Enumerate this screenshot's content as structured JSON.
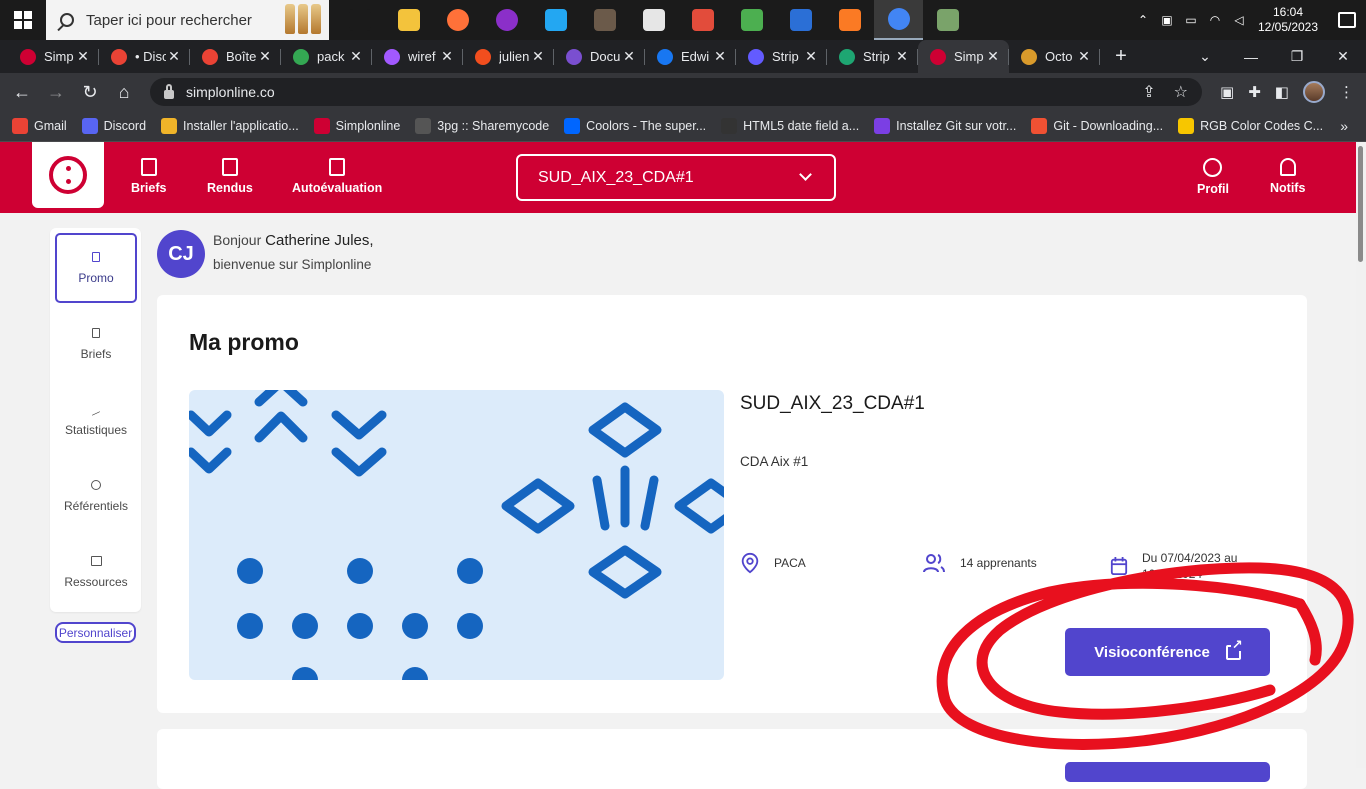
{
  "taskbar": {
    "search_placeholder": "Taper ici pour rechercher",
    "apps": [
      {
        "icon": "task-view-icon",
        "color": "#1b1b1b"
      },
      {
        "icon": "file-explorer-icon",
        "color": "#f3c33c"
      },
      {
        "icon": "firefox-icon",
        "color": "#ff7139"
      },
      {
        "icon": "private-browser-icon",
        "color": "#8b2fc9"
      },
      {
        "icon": "vscode-icon",
        "color": "#23a7f2"
      },
      {
        "icon": "gimp-icon",
        "color": "#6b5a4a"
      },
      {
        "icon": "document-icon",
        "color": "#e6e6e6"
      },
      {
        "icon": "git-bash-icon",
        "color": "#e24c3b"
      },
      {
        "icon": "sourcetree-icon",
        "color": "#4caf50"
      },
      {
        "icon": "powershell-icon",
        "color": "#2b6fd6"
      },
      {
        "icon": "xampp-icon",
        "color": "#fb7a24"
      },
      {
        "icon": "chrome-icon",
        "color": "#4285f4"
      },
      {
        "icon": "photo-app-icon",
        "color": "#7aa36a"
      }
    ],
    "time": "16:04",
    "date": "12/05/2023"
  },
  "browser": {
    "tabs": [
      {
        "title": "Simp",
        "color": "#ce0033",
        "active": false
      },
      {
        "title": "• Disc",
        "color": "#ea4335",
        "active": false
      },
      {
        "title": "Boîte",
        "color": "#ea4335",
        "active": false
      },
      {
        "title": "pack",
        "color": "#34a853",
        "active": false
      },
      {
        "title": "wiref",
        "color": "#a259ff",
        "active": false
      },
      {
        "title": "julien",
        "color": "#f24e1e",
        "active": false
      },
      {
        "title": "Docu",
        "color": "#7a4fd0",
        "active": false
      },
      {
        "title": "Edwi",
        "color": "#1877f2",
        "active": false
      },
      {
        "title": "Strip",
        "color": "#635bff",
        "active": false
      },
      {
        "title": "Strip",
        "color": "#1ea672",
        "active": false
      },
      {
        "title": "Simp",
        "color": "#ce0033",
        "active": true
      },
      {
        "title": "Octo",
        "color": "#d99a2b",
        "active": false
      }
    ],
    "url": "simplonline.co",
    "bookmarks": [
      {
        "label": "Gmail",
        "color": "#ea4335"
      },
      {
        "label": "Discord",
        "color": "#5865f2"
      },
      {
        "label": "Installer l'applicatio...",
        "color": "#f0b429"
      },
      {
        "label": "Simplonline",
        "color": "#ce0033"
      },
      {
        "label": "3pg :: Sharemycode",
        "color": "#555555"
      },
      {
        "label": "Coolors - The super...",
        "color": "#0066ff"
      },
      {
        "label": "HTML5 date field a...",
        "color": "#333333"
      },
      {
        "label": "Installez Git sur votr...",
        "color": "#7b3fe4"
      },
      {
        "label": "Git - Downloading...",
        "color": "#f05133"
      },
      {
        "label": "RGB Color Codes C...",
        "color": "#f7c600"
      }
    ],
    "bookmarks_more": "»"
  },
  "app": {
    "brand_color": "#ce0033",
    "accent_color": "#5145cd",
    "nav": {
      "briefs": "Briefs",
      "rendus": "Rendus",
      "autoevaluation": "Autoévaluation",
      "profil": "Profil",
      "notifs": "Notifs"
    },
    "promo_select": "SUD_AIX_23_CDA#1",
    "sidebar": {
      "items": [
        "Promo",
        "Briefs",
        "Statistiques",
        "Référentiels",
        "Ressources"
      ],
      "customize": "Personnaliser"
    },
    "user": {
      "initials": "CJ",
      "greeting": "Bonjour",
      "name": "Catherine Jules,",
      "welcome": "bienvenue sur Simplonline"
    },
    "card": {
      "title": "Ma promo",
      "promo_name": "SUD_AIX_23_CDA#1",
      "promo_desc": "CDA Aix #1",
      "region": "PACA",
      "learners": "14 apprenants",
      "dates_line1": "Du 07/04/2023 au",
      "dates_line2": "10/01/2024",
      "visio_button": "Visioconférence"
    }
  }
}
